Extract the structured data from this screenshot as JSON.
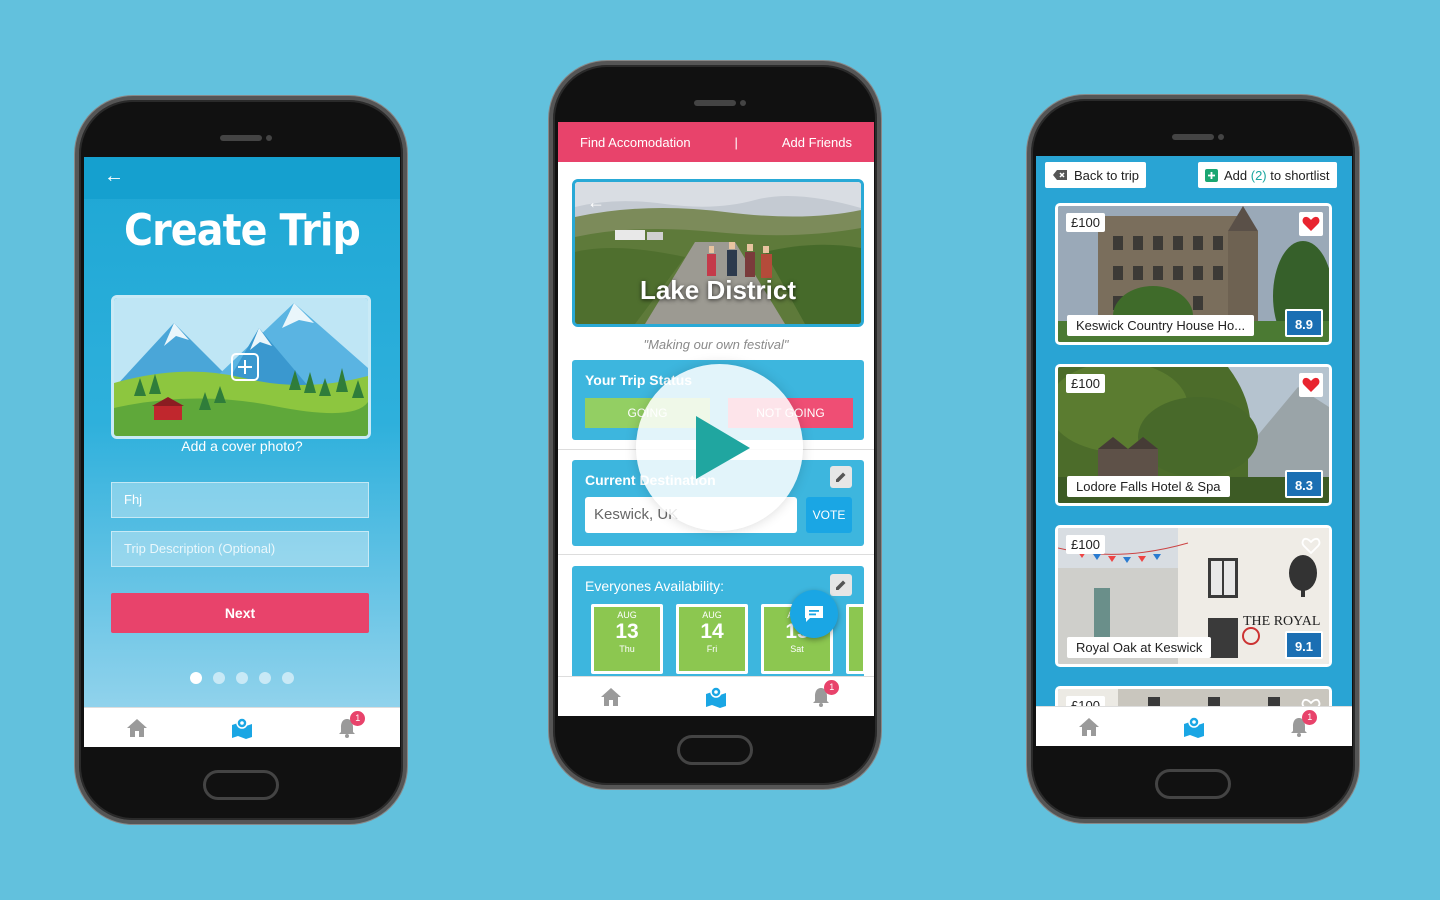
{
  "phone1": {
    "title": "Create Trip",
    "cover_caption": "Add a cover photo?",
    "trip_name_value": "Fhj",
    "description_placeholder": "Trip Description (Optional)",
    "next_label": "Next",
    "steps": [
      true,
      false,
      false,
      false,
      false
    ],
    "notification_count": "1"
  },
  "phone2": {
    "top_bar": {
      "find_accommodation": "Find Accomodation",
      "separator": "|",
      "add_friends": "Add Friends"
    },
    "hero_title": "Lake District",
    "tagline": "\"Making our own festival\"",
    "status": {
      "title": "Your Trip Status",
      "going": "GOING",
      "not_going": "NOT GOING"
    },
    "destination": {
      "title": "Current Destination",
      "value": "Keswick, UK",
      "vote_label": "VOTE"
    },
    "availability": {
      "title": "Everyones Availability:",
      "days": [
        {
          "month": "AUG",
          "day": "13",
          "dow": "Thu"
        },
        {
          "month": "AUG",
          "day": "14",
          "dow": "Fri"
        },
        {
          "month": "AUG",
          "day": "15",
          "dow": "Sat"
        }
      ]
    },
    "notification_count": "1"
  },
  "phone3": {
    "back_label": "Back to trip",
    "shortlist": {
      "prefix": "Add ",
      "count": "(2)",
      "suffix": " to shortlist"
    },
    "hotels": [
      {
        "price": "£100",
        "name": "Keswick Country House Ho...",
        "score": "8.9",
        "favourite": true
      },
      {
        "price": "£100",
        "name": "Lodore Falls Hotel & Spa",
        "score": "8.3",
        "favourite": true
      },
      {
        "price": "£100",
        "name": "Royal Oak at Keswick",
        "score": "9.1",
        "favourite": false,
        "sign": "THE ROYAL"
      },
      {
        "price": "£100",
        "name": "",
        "score": "",
        "favourite": false
      }
    ],
    "notification_count": "1"
  },
  "colors": {
    "background": "#62c1dd",
    "primary_blue": "#1aa6e4",
    "accent_pink": "#e8436b",
    "going_green": "#93cf63",
    "score_blue": "#1b6fb3"
  }
}
